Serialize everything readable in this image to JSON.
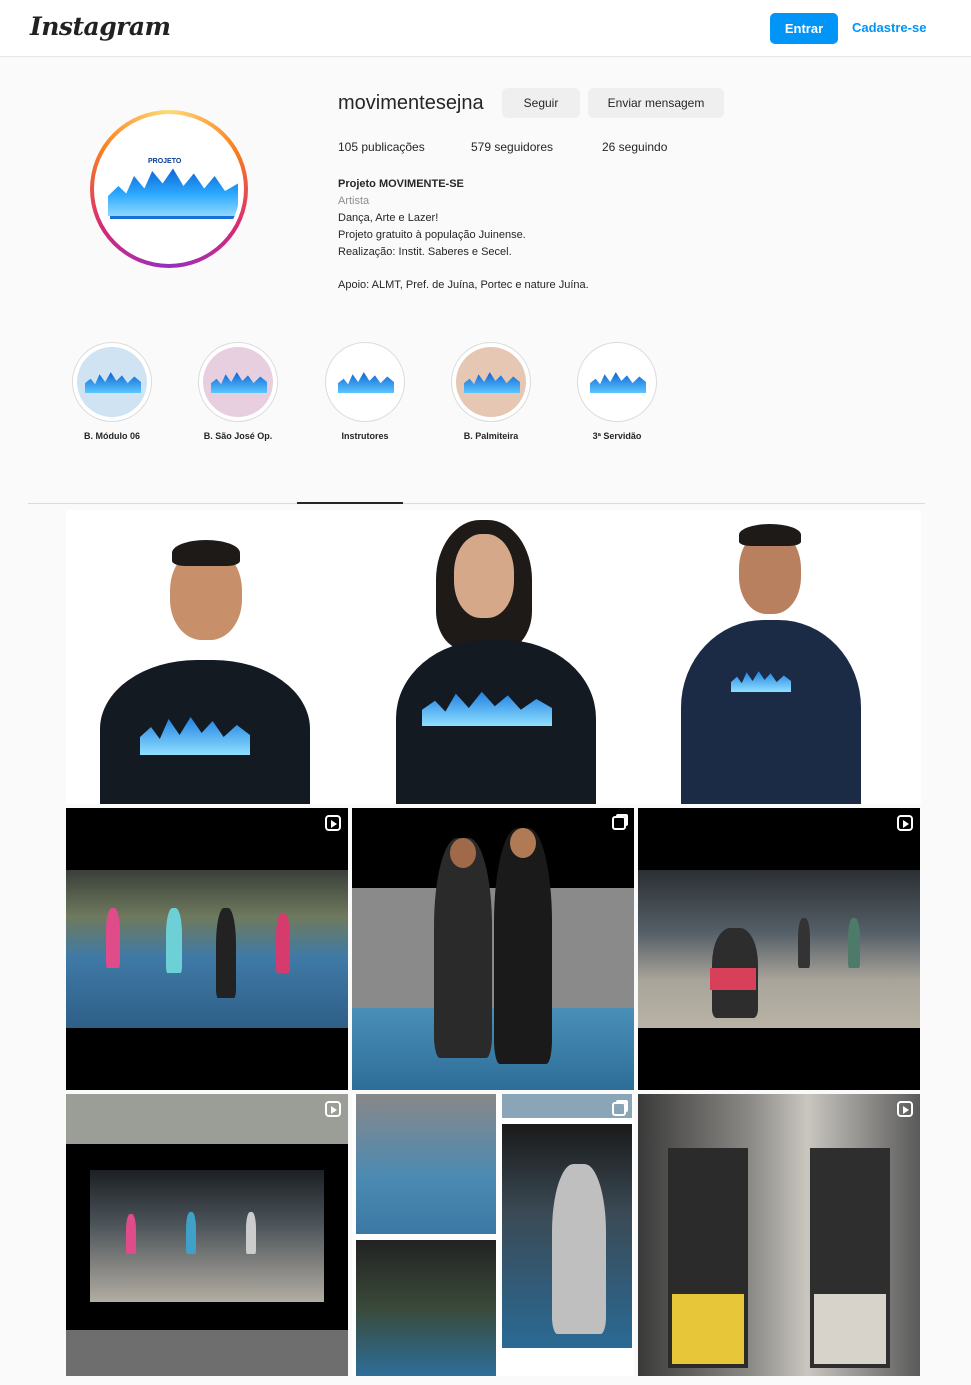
{
  "header": {
    "logo": "Instagram",
    "login_label": "Entrar",
    "signup_label": "Cadastre-se"
  },
  "profile": {
    "username": "movimentesejna",
    "follow_label": "Seguir",
    "message_label": "Enviar mensagem",
    "stats": {
      "posts": "105 publicações",
      "followers": "579 seguidores",
      "following": "26 seguindo"
    },
    "bio": {
      "name": "Projeto MOVIMENTE-SE",
      "category": "Artista",
      "lines": [
        "Dança, Arte e Lazer!",
        "Projeto gratuito à população Juinense.",
        "Realização: Instit. Saberes e Secel."
      ],
      "support": "Apoio: ALMT, Pref. de Juína, Portec e nature Juína."
    }
  },
  "highlights": [
    {
      "label": "B. Módulo 06",
      "tint": "#cfe3f2"
    },
    {
      "label": "B. São José Op.",
      "tint": "#e8cfe0"
    },
    {
      "label": "Instrutores",
      "tint": "#ffffff"
    },
    {
      "label": "B. Palmiteira",
      "tint": "#e6c7b3"
    },
    {
      "label": "3ª Servidão",
      "tint": "#ffffff"
    }
  ],
  "grid": {
    "banner_alt": "Instrutores do Projeto Movimente-se",
    "posts": [
      {
        "type": "reel"
      },
      {
        "type": "carousel"
      },
      {
        "type": "reel"
      },
      {
        "type": "reel"
      },
      {
        "type": "carousel"
      },
      {
        "type": "reel"
      }
    ]
  }
}
